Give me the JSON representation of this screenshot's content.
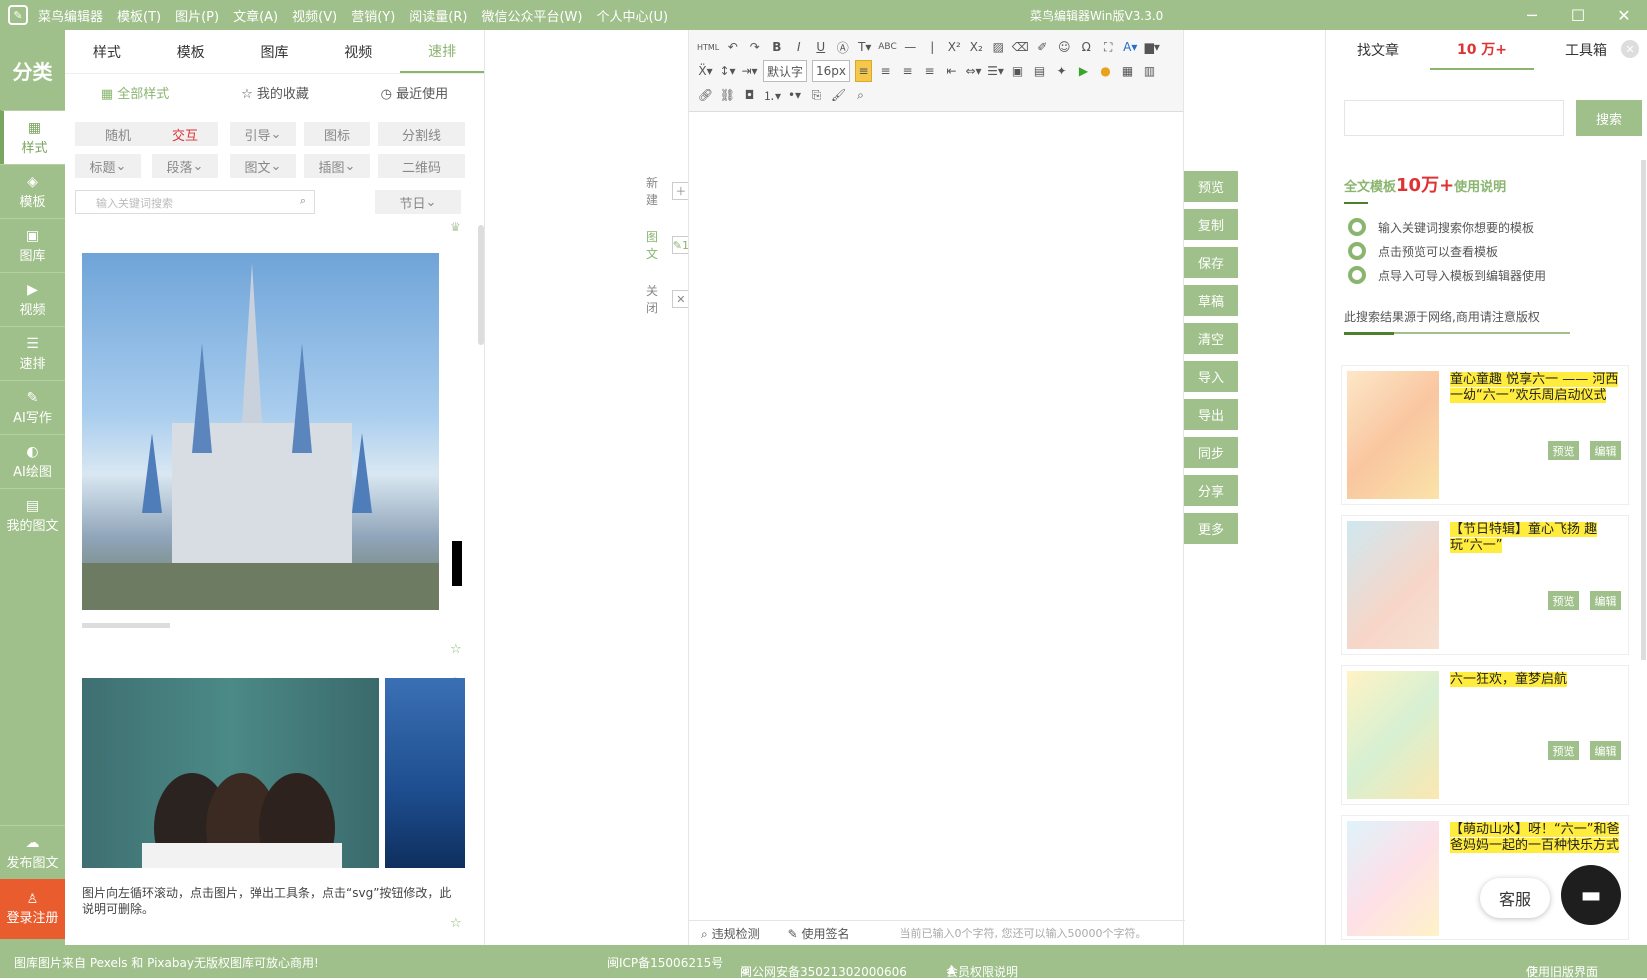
{
  "titlebar": {
    "menu": [
      "菜鸟编辑器",
      "模板(T)",
      "图片(P)",
      "文章(A)",
      "视频(V)",
      "营销(Y)",
      "阅读量(R)",
      "微信公众平台(W)",
      "个人中心(U)"
    ],
    "title": "菜鸟编辑器Win版V3.3.0",
    "controls": [
      "─",
      "☐",
      "✕"
    ]
  },
  "leftnav": {
    "heading": "分类",
    "items": [
      {
        "label": "样式",
        "icon": "grid-icon"
      },
      {
        "label": "模板",
        "icon": "layers-icon"
      },
      {
        "label": "图库",
        "icon": "image-icon"
      },
      {
        "label": "视频",
        "icon": "video-icon"
      },
      {
        "label": "速排",
        "icon": "sliders-icon"
      },
      {
        "label": "AI写作",
        "icon": "pen-icon"
      },
      {
        "label": "AI绘图",
        "icon": "palette-icon"
      },
      {
        "label": "我的图文",
        "icon": "document-icon"
      }
    ],
    "publish": "发布图文",
    "login": "登录注册"
  },
  "panel": {
    "tabs": [
      "样式",
      "模板",
      "图库",
      "视频",
      "速排"
    ],
    "active_tab": "速排",
    "subtabs": [
      "全部样式",
      "我的收藏",
      "最近使用"
    ],
    "chips_row1": [
      "随机",
      "交互",
      "引导",
      "图标",
      "分割线"
    ],
    "chips_row2": [
      "标题",
      "段落",
      "图文",
      "插图",
      "二维码"
    ],
    "search_placeholder": "输入关键词搜索",
    "holiday": "节日",
    "description": "图片向左循环滚动，点击图片，弹出工具条，点击“svg”按钮修改，此说明可删除。"
  },
  "mid": {
    "new": "新建",
    "tuwen": "图文",
    "close": "关闭"
  },
  "editor": {
    "font": "默认字",
    "size": "16px",
    "status_check": "违规检测",
    "status_sign": "使用签名",
    "char_info": "当前已输入0个字符, 您还可以输入50000个字符。"
  },
  "side_buttons": [
    "预览",
    "复制",
    "保存",
    "草稿",
    "清空",
    "导入",
    "导出",
    "同步",
    "分享",
    "更多"
  ],
  "right": {
    "tabs": [
      "找文章",
      "10 万+",
      "工具箱"
    ],
    "search_button": "搜索",
    "heading_prefix": "全文模板",
    "heading_big": "10万+",
    "heading_suffix": "使用说明",
    "tips": [
      "输入关键词搜索你想要的模板",
      "点击预览可以查看模板",
      "点导入可导入模板到编辑器使用"
    ],
    "note": "此搜索结果源于网络,商用请注意版权",
    "items": [
      {
        "title": "童心童趣 悦享六一 —— 河西一幼“六一”欢乐周启动仪式"
      },
      {
        "title": "【节日特辑】童心飞扬 趣玩“六一”"
      },
      {
        "title": "六一狂欢，童梦启航"
      },
      {
        "title": "【萌动山水】呀！“六一”和爸爸妈妈一起的一百种快乐方式"
      }
    ],
    "preview": "预览",
    "edit": "编辑",
    "kefu": "客服"
  },
  "footer": {
    "left": "图库图片来自 Pexels 和 Pixabay无版权图库可放心商用!",
    "icp": "闽ICP备15006215号",
    "police": "闽公网安备35021302000606",
    "member": "会员权限说明",
    "old": "使用旧版界面"
  },
  "colors": {
    "accent": "#9fc08a",
    "danger": "#e85c2d",
    "highlight": "#ffec3d"
  }
}
